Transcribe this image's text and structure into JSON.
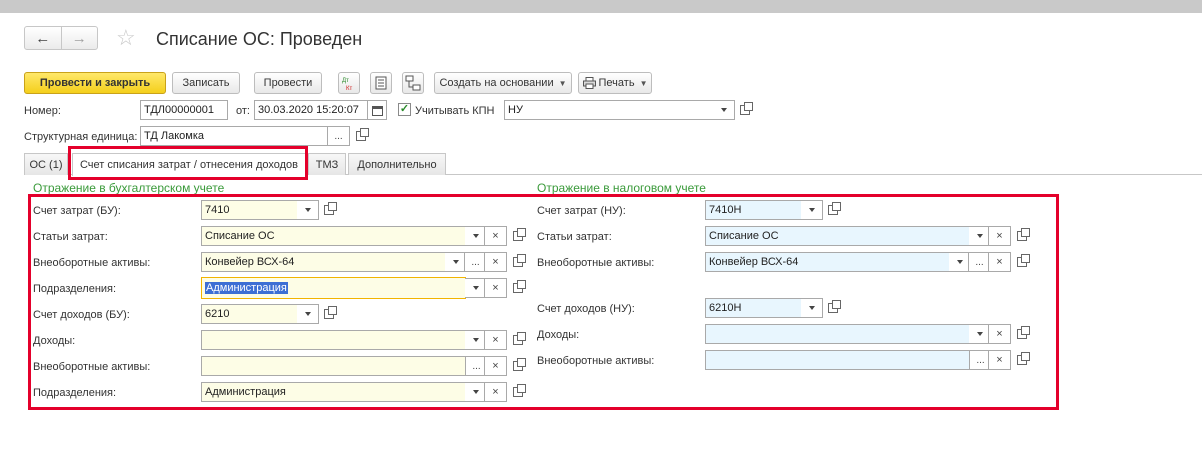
{
  "document": {
    "title": "Списание ОС: Проведен"
  },
  "nav": {
    "back_icon": "arrow-left-icon",
    "forward_icon": "arrow-right-icon",
    "star_icon": "star-icon"
  },
  "toolbar": {
    "post_close": "Провести и закрыть",
    "save": "Записать",
    "post": "Провести",
    "dtkt_icon": "dt-kt-icon",
    "list_icon": "document-list-icon",
    "structure_icon": "structure-icon",
    "create_based": "Создать на основании",
    "print": "Печать",
    "print_icon": "printer-icon"
  },
  "header": {
    "number_label": "Номер:",
    "number_value": "ТДЛ00000001",
    "date_label": "от:",
    "date_value": "30.03.2020 15:20:07",
    "kpn_label": "Учитывать КПН",
    "kpn_checked": "✓",
    "kpn_value": "НУ",
    "unit_label": "Структурная единица:",
    "unit_value": "ТД Лакомка"
  },
  "tabs": [
    "ОС (1)",
    "Счет списания затрат / отнесения доходов",
    "ТМЗ",
    "Дополнительно"
  ],
  "bu": {
    "section_title": "Отражение в бухгалтерском учете",
    "rows": [
      {
        "label": "Счет затрат (БУ):",
        "value": "7410"
      },
      {
        "label": "Статьи затрат:",
        "value": "Списание ОС"
      },
      {
        "label": "Внеоборотные активы:",
        "value": "Конвейер ВСХ-64"
      },
      {
        "label": "Подразделения:",
        "value": "Администрация"
      },
      {
        "label": "Счет доходов (БУ):",
        "value": "6210"
      },
      {
        "label": "Доходы:",
        "value": ""
      },
      {
        "label": "Внеоборотные активы:",
        "value": ""
      },
      {
        "label": "Подразделения:",
        "value": "Администрация"
      }
    ]
  },
  "nu": {
    "section_title": "Отражение в налоговом учете",
    "rows": [
      {
        "label": "Счет затрат (НУ):",
        "value": "7410Н"
      },
      {
        "label": "Статьи затрат:",
        "value": "Списание ОС"
      },
      {
        "label": "Внеоборотные активы:",
        "value": "Конвейер ВСХ-64"
      },
      {
        "label": "Счет доходов (НУ):",
        "value": "6210Н"
      },
      {
        "label": "Доходы:",
        "value": ""
      },
      {
        "label": "Внеоборотные активы:",
        "value": ""
      }
    ]
  },
  "colors": {
    "highlight": "#e4002b",
    "section_title": "#3a9a3a",
    "primary_button": "#f4cf1b"
  }
}
